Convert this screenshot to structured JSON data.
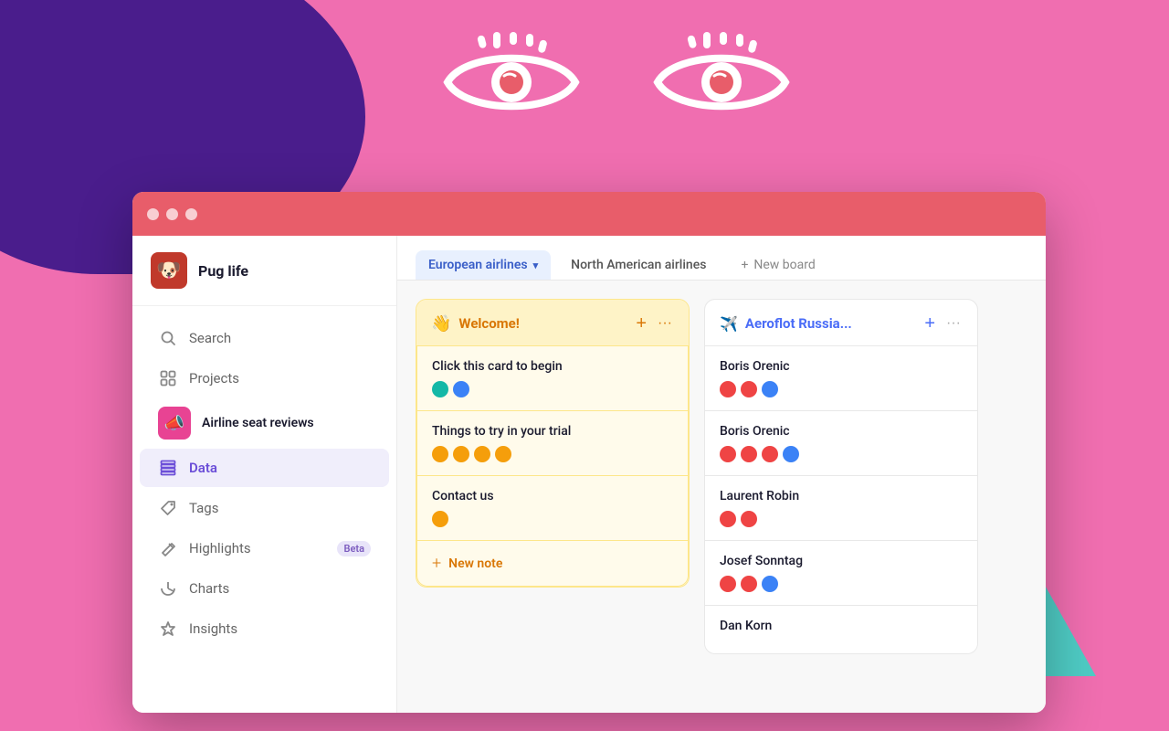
{
  "background": {
    "primaryColor": "#f06eb0",
    "accentColor": "#4a1d8c"
  },
  "window": {
    "titleBarColor": "#e85d6a"
  },
  "sidebar": {
    "workspace_name": "Pug life",
    "workspace_emoji": "🐶",
    "nav_items": [
      {
        "id": "search",
        "label": "Search",
        "icon": "search"
      },
      {
        "id": "projects",
        "label": "Projects",
        "icon": "projects"
      },
      {
        "id": "airline-seat-reviews",
        "label": "Airline seat reviews",
        "icon": "megaphone",
        "isProject": true
      },
      {
        "id": "data",
        "label": "Data",
        "icon": "data",
        "active": true
      },
      {
        "id": "tags",
        "label": "Tags",
        "icon": "tag"
      },
      {
        "id": "highlights",
        "label": "Highlights",
        "icon": "highlights",
        "badge": "Beta"
      },
      {
        "id": "charts",
        "label": "Charts",
        "icon": "charts"
      },
      {
        "id": "insights",
        "label": "Insights",
        "icon": "insights"
      }
    ]
  },
  "tabs": [
    {
      "id": "european-airlines",
      "label": "European airlines",
      "active": true
    },
    {
      "id": "north-american-airlines",
      "label": "North American airlines",
      "active": false
    },
    {
      "id": "new-board",
      "label": "New board",
      "isNew": true
    }
  ],
  "columns": [
    {
      "id": "welcome",
      "title": "Welcome!",
      "emoji": "👋",
      "theme": "yellow",
      "cards": [
        {
          "id": "card-1",
          "title": "Click this card to begin",
          "dots": [
            "teal",
            "blue"
          ]
        },
        {
          "id": "card-2",
          "title": "Things to try in your trial",
          "dots": [
            "orange",
            "orange",
            "orange",
            "orange"
          ]
        },
        {
          "id": "card-3",
          "title": "Contact us",
          "dots": [
            "orange"
          ]
        }
      ],
      "new_note_label": "New note"
    },
    {
      "id": "aeroflot",
      "title": "Aeroflot Russia...",
      "emoji": "✈️",
      "theme": "white",
      "cards": [
        {
          "id": "card-4",
          "title": "Boris Orenic",
          "dots": [
            "red",
            "red",
            "blue"
          ]
        },
        {
          "id": "card-5",
          "title": "Boris Orenic",
          "dots": [
            "red",
            "red",
            "red",
            "blue"
          ]
        },
        {
          "id": "card-6",
          "title": "Laurent Robin",
          "dots": [
            "red",
            "red"
          ]
        },
        {
          "id": "card-7",
          "title": "Josef Sonntag",
          "dots": [
            "red",
            "red",
            "blue"
          ]
        },
        {
          "id": "card-8",
          "title": "Dan Korn",
          "dots": []
        }
      ]
    }
  ]
}
